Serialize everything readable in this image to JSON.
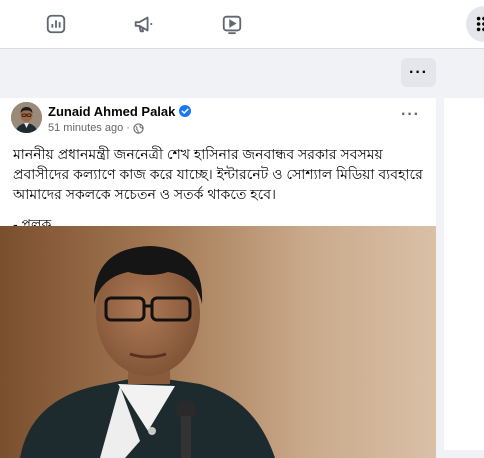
{
  "nav": {
    "items": [
      {
        "name": "insights-icon"
      },
      {
        "name": "megaphone-icon"
      },
      {
        "name": "video-play-icon"
      }
    ],
    "grid_icon": "grid-menu-icon"
  },
  "colors": {
    "background": "#f0f2f5",
    "card": "#ffffff",
    "verified_blue": "#1877f2",
    "muted_text": "#65676b"
  },
  "page_more_label": "···",
  "post": {
    "author": "Zunaid Ahmed Palak",
    "verified": true,
    "time": "51 minutes ago",
    "dot": "·",
    "privacy_icon": "globe-icon",
    "more_label": "···",
    "text_lines": [
      "মাননীয় প্রধানমন্ত্রী জননেত্রী শেখ হাসিনার জনবান্ধব সরকার সবসময় প্রবাসীদের কল্যাণে কাজ করে যাচ্ছে। ইন্টারনেট ও সোশ্যাল মিডিয়া ব্যবহারে আমাদের সকলকে সচেতন ও সতর্ক থাকতে হবে।"
    ],
    "signature": "- পলক"
  }
}
